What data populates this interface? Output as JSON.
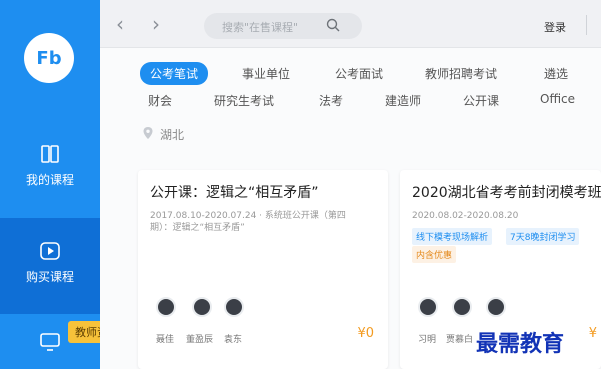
{
  "sidebar": {
    "logo_text": "Fb",
    "items": [
      {
        "label": "我的课程",
        "icon": "book-icon"
      },
      {
        "label": "购买课程",
        "icon": "play-icon"
      },
      {
        "label": "",
        "icon": "screen-icon"
      }
    ],
    "cert_tag": "教师资格证"
  },
  "topbar": {
    "search_placeholder": "搜索\"在售课程\"",
    "login_label": "登录"
  },
  "categories": {
    "row1": [
      "公考笔试",
      "事业单位",
      "公考面试",
      "教师招聘考试",
      "遴选"
    ],
    "row2": [
      "财会",
      "研究生考试",
      "法考",
      "建造师",
      "公开课",
      "Office"
    ],
    "active": "公考笔试",
    "location": "湖北"
  },
  "cards": [
    {
      "title": "公开课：逻辑之“相互矛盾”",
      "date_line1": "2017.08.10-2020.07.24 · 系统班公开课（第四",
      "date_line2": "期）：逻辑之“相互矛盾”",
      "teachers": [
        "聂佳",
        "董盈辰",
        "袁东"
      ],
      "price": "¥0"
    },
    {
      "title": "2020湖北省考考前封闭模考班",
      "date_line1": "2020.08.02-2020.08.20",
      "tags_blue": [
        "线下模考现场解析",
        "7天8晚封闭学习"
      ],
      "tag_orange": "内含优惠",
      "teachers": [
        "习明",
        "贾慕白",
        ""
      ],
      "price": "¥"
    }
  ],
  "watermark": "最需教育",
  "colors": {
    "primary": "#1e8ef0",
    "accent": "#f39b20",
    "tag_yellow": "#f7c23a"
  }
}
